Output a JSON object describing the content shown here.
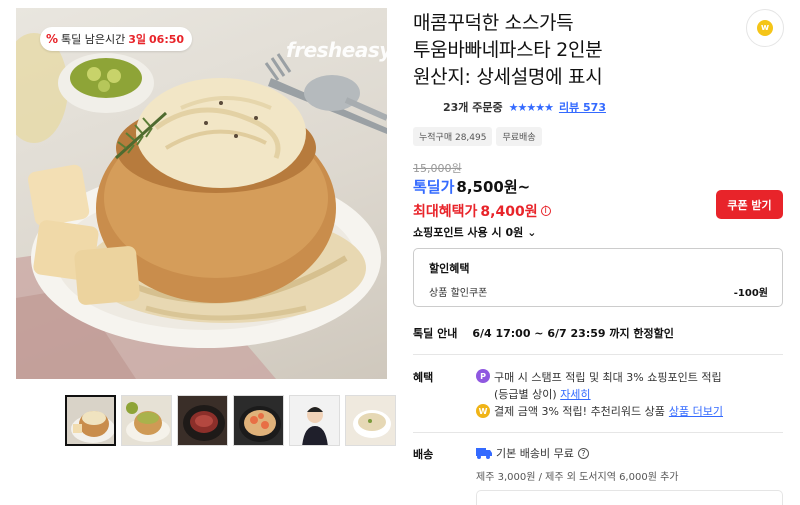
{
  "colors": {
    "accent_blue": "#346aff",
    "accent_red": "#e8242a",
    "point_purple": "#8f58e0",
    "wow_yellow": "#f0b417"
  },
  "product_image": {
    "timer": {
      "prefix_icon": "%",
      "label": "톡딜 남은시간",
      "days": "3일",
      "time": "06:50"
    },
    "brand_watermark": "fresheasy"
  },
  "thumbnails": [
    {
      "name": "thumb-bread-bowl-pasta",
      "selected": true
    },
    {
      "name": "thumb-pasta-side-view",
      "selected": false
    },
    {
      "name": "thumb-steak-skillet",
      "selected": false
    },
    {
      "name": "thumb-shrimp-pan",
      "selected": false
    },
    {
      "name": "thumb-chef-person",
      "selected": false
    },
    {
      "name": "thumb-cream-soup-bowl",
      "selected": false
    }
  ],
  "favorite_badge": "w",
  "product": {
    "title_lines": [
      "매콤꾸덕한 소스가득",
      "투움바빠네파스타 2인분",
      "원산지: 상세설명에 표시"
    ],
    "order_count": "23개 주문중",
    "stars": "★★★★★",
    "rating": 4.5,
    "review_link": "리뷰 573",
    "chips": [
      "누적구매 28,495",
      "무료배송"
    ],
    "original_price": "15,000원",
    "deal_label": "톡딜가",
    "deal_price": "8,500원~",
    "max_benefit_label": "최대혜택가",
    "max_benefit_price": "8,400원",
    "info_icon": "i",
    "coupon_button": "쿠폰 받기",
    "points_text": "쇼핑포인트 사용 시 0원",
    "points_chevron": "⌄"
  },
  "discount_box": {
    "heading": "할인혜택",
    "row_label": "상품 할인쿠폰",
    "row_value": "-100원"
  },
  "sale_info": {
    "key": "톡딜 안내",
    "value": "6/4 17:00 ~ 6/7 23:59 까지 한정할인"
  },
  "benefits": {
    "key": "혜택",
    "p_icon": "P",
    "line1": "구매 시 스탬프 적립 및 최대 3% 쇼핑포인트 적립",
    "line2": "(등급별 상이)",
    "detail_link": "자세히",
    "w_icon": "W",
    "line3": "결제 금액 3% 적립! 추천리워드 상품",
    "more_link": "상품 더보기"
  },
  "shipping": {
    "key": "배송",
    "truck_icon": "truck-icon",
    "base": "기본 배송비 무료",
    "q_icon": "?",
    "extra": "제주 3,000원 / 제주 외 도서지역 6,000원 추가"
  }
}
